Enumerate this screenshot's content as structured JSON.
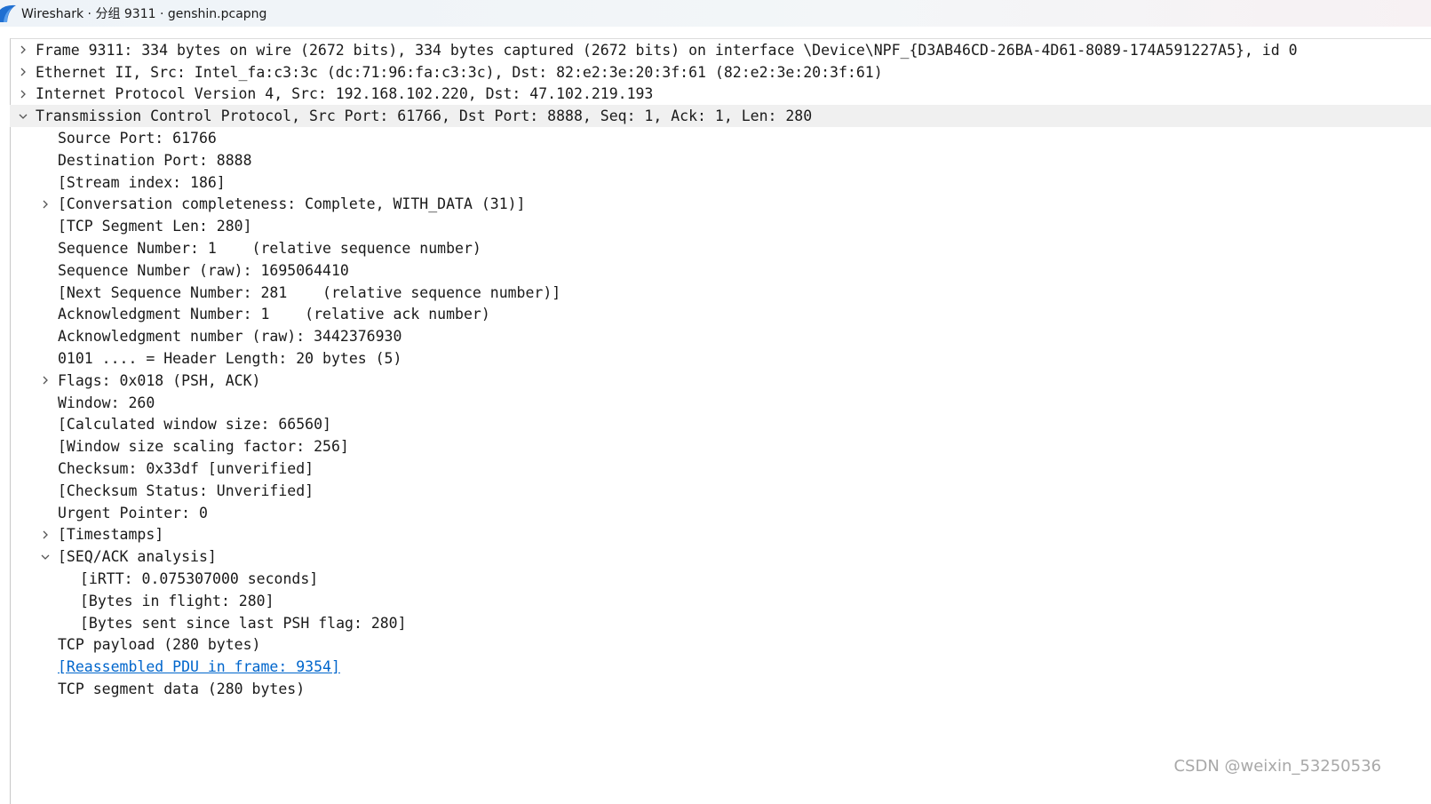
{
  "window": {
    "title": "Wireshark · 分组 9311 · genshin.pcapng",
    "icon": "wireshark-fin-icon",
    "accent": "#1f6fd1"
  },
  "tree": {
    "link_color": "#0066cc",
    "rows": [
      {
        "level": 0,
        "toggle": "collapsed",
        "text": "Frame 9311: 334 bytes on wire (2672 bits), 334 bytes captured (2672 bits) on interface \\Device\\NPF_{D3AB46CD-26BA-4D61-8089-174A591227A5}, id 0"
      },
      {
        "level": 0,
        "toggle": "collapsed",
        "text": "Ethernet II, Src: Intel_fa:c3:3c (dc:71:96:fa:c3:3c), Dst: 82:e2:3e:20:3f:61 (82:e2:3e:20:3f:61)"
      },
      {
        "level": 0,
        "toggle": "collapsed",
        "text": "Internet Protocol Version 4, Src: 192.168.102.220, Dst: 47.102.219.193"
      },
      {
        "level": 0,
        "toggle": "expanded",
        "text": "Transmission Control Protocol, Src Port: 61766, Dst Port: 8888, Seq: 1, Ack: 1, Len: 280"
      },
      {
        "level": 1,
        "toggle": "none",
        "text": "Source Port: 61766"
      },
      {
        "level": 1,
        "toggle": "none",
        "text": "Destination Port: 8888"
      },
      {
        "level": 1,
        "toggle": "none",
        "text": "[Stream index: 186]"
      },
      {
        "level": 1,
        "toggle": "collapsed",
        "text": "[Conversation completeness: Complete, WITH_DATA (31)]"
      },
      {
        "level": 1,
        "toggle": "none",
        "text": "[TCP Segment Len: 280]"
      },
      {
        "level": 1,
        "toggle": "none",
        "text": "Sequence Number: 1    (relative sequence number)"
      },
      {
        "level": 1,
        "toggle": "none",
        "text": "Sequence Number (raw): 1695064410"
      },
      {
        "level": 1,
        "toggle": "none",
        "text": "[Next Sequence Number: 281    (relative sequence number)]"
      },
      {
        "level": 1,
        "toggle": "none",
        "text": "Acknowledgment Number: 1    (relative ack number)"
      },
      {
        "level": 1,
        "toggle": "none",
        "text": "Acknowledgment number (raw): 3442376930"
      },
      {
        "level": 1,
        "toggle": "none",
        "text": "0101 .... = Header Length: 20 bytes (5)"
      },
      {
        "level": 1,
        "toggle": "collapsed",
        "text": "Flags: 0x018 (PSH, ACK)"
      },
      {
        "level": 1,
        "toggle": "none",
        "text": "Window: 260"
      },
      {
        "level": 1,
        "toggle": "none",
        "text": "[Calculated window size: 66560]"
      },
      {
        "level": 1,
        "toggle": "none",
        "text": "[Window size scaling factor: 256]"
      },
      {
        "level": 1,
        "toggle": "none",
        "text": "Checksum: 0x33df [unverified]"
      },
      {
        "level": 1,
        "toggle": "none",
        "text": "[Checksum Status: Unverified]"
      },
      {
        "level": 1,
        "toggle": "none",
        "text": "Urgent Pointer: 0"
      },
      {
        "level": 1,
        "toggle": "collapsed",
        "text": "[Timestamps]"
      },
      {
        "level": 1,
        "toggle": "expanded",
        "text": "[SEQ/ACK analysis]"
      },
      {
        "level": 2,
        "toggle": "none",
        "text": "[iRTT: 0.075307000 seconds]"
      },
      {
        "level": 2,
        "toggle": "none",
        "text": "[Bytes in flight: 280]"
      },
      {
        "level": 2,
        "toggle": "none",
        "text": "[Bytes sent since last PSH flag: 280]"
      },
      {
        "level": 1,
        "toggle": "none",
        "text": "TCP payload (280 bytes)"
      },
      {
        "level": 1,
        "toggle": "none",
        "link": true,
        "text": "[Reassembled PDU in frame: 9354]"
      },
      {
        "level": 1,
        "toggle": "none",
        "text": "TCP segment data (280 bytes)"
      }
    ]
  },
  "watermark": {
    "text": "CSDN @weixin_53250536"
  }
}
